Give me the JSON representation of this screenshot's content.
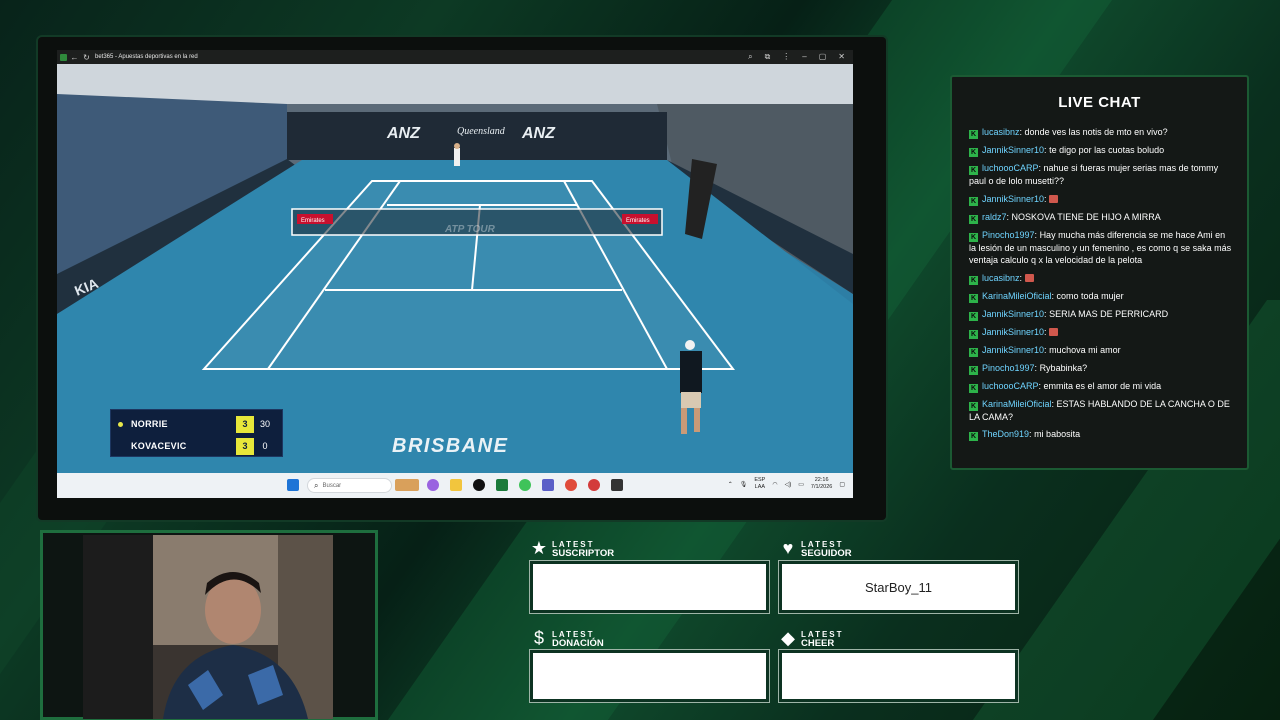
{
  "browser": {
    "title": "bet365 - Apuestas deportivas en la red",
    "controls": [
      "zoom-icon",
      "extensions-icon",
      "menu-icon",
      "minimize-icon",
      "restore-icon",
      "close-icon"
    ]
  },
  "video": {
    "scoreboard": {
      "players": [
        {
          "name": "NORRIE",
          "sets": "3",
          "points": "30",
          "serving": true
        },
        {
          "name": "KOVACEVIC",
          "sets": "3",
          "points": "0",
          "serving": false
        }
      ]
    },
    "city": "BRISBANE",
    "sponsors": [
      "ANZ",
      "Queensland",
      "ANZ",
      "Emirates",
      "ATP TOUR",
      "KIA"
    ]
  },
  "taskbar": {
    "search_placeholder": "Buscar",
    "lang": "ESP",
    "lang_sub": "LAA",
    "time": "22:16",
    "date": "7/1/2026"
  },
  "chat": {
    "title": "LIVE CHAT",
    "messages": [
      {
        "user": "lucasibnz",
        "text": "donde ves las notis de mto en vivo?"
      },
      {
        "user": "JannikSinner10",
        "text": "te digo por las cuotas boludo"
      },
      {
        "user": "luchoooCARP",
        "text": "nahue si fueras mujer serias mas de tommy paul o de lolo musetti??"
      },
      {
        "user": "JannikSinner10",
        "text": "",
        "emote": true
      },
      {
        "user": "raldz7",
        "text": "NOSKOVA TIENE DE HIJO A MIRRA"
      },
      {
        "user": "Pinocho1997",
        "text": "Hay mucha más diferencia se me hace Ami en la lesión de un masculino y un femenino , es como q se saka más ventaja calculo q x la velocidad de la pelota"
      },
      {
        "user": "lucasibnz",
        "text": "",
        "emote": true
      },
      {
        "user": "KarinaMileiOficial",
        "text": "como toda mujer"
      },
      {
        "user": "JannikSinner10",
        "text": "SERIA MAS DE PERRICARD"
      },
      {
        "user": "JannikSinner10",
        "text": "",
        "emote": true
      },
      {
        "user": "JannikSinner10",
        "text": "muchova mi amor"
      },
      {
        "user": "Pinocho1997",
        "text": "Rybabinka?"
      },
      {
        "user": "luchoooCARP",
        "text": "emmita es el amor de mi vida"
      },
      {
        "user": "KarinaMileiOficial",
        "text": "ESTAS HABLANDO DE LA CANCHA O DE LA CAMA?"
      },
      {
        "user": "TheDon919",
        "text": "mi babosita"
      }
    ]
  },
  "widgets": {
    "subscriber": {
      "small": "LATEST",
      "big": "SUSCRIPTOR",
      "icon": "star-icon",
      "value": ""
    },
    "follower": {
      "small": "LATEST",
      "big": "SEGUIDOR",
      "icon": "heart-icon",
      "value": "StarBoy_11"
    },
    "donation": {
      "small": "LATEST",
      "big": "DONACIÓN",
      "icon": "dollar-icon",
      "value": ""
    },
    "cheer": {
      "small": "LATEST",
      "big": "CHEER",
      "icon": "diamond-icon",
      "value": ""
    }
  },
  "colors": {
    "accent_green": "#2db34a",
    "username": "#6fd4ff",
    "court": "#2d7ea5",
    "score_bg": "#0e1f3d",
    "score_highlight": "#e8e83a"
  }
}
